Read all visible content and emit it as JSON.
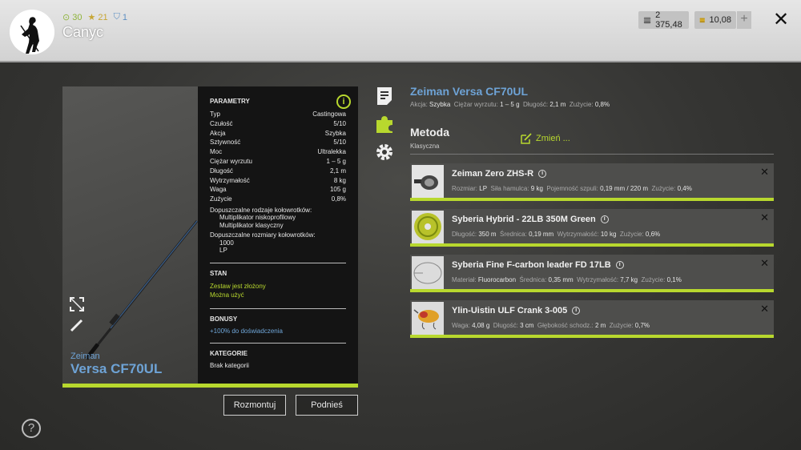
{
  "player": {
    "name": "Canyc",
    "stat_level": "30",
    "stat_stars": "21",
    "stat_third": "1"
  },
  "currency": {
    "silver": "2 375,48",
    "gold": "10,08",
    "add_symbol": "+"
  },
  "close_symbol": "✕",
  "item": {
    "brand": "Zeiman",
    "model": "Versa CF70UL",
    "info_symbol": "i"
  },
  "params": {
    "title": "PARAMETRY",
    "rows": [
      {
        "k": "Typ",
        "v": "Castingowa"
      },
      {
        "k": "Czułość",
        "v": "5/10"
      },
      {
        "k": "Akcja",
        "v": "Szybka"
      },
      {
        "k": "Sztywność",
        "v": "5/10"
      },
      {
        "k": "Moc",
        "v": "Ultralekka"
      },
      {
        "k": "Ciężar wyrzutu",
        "v": "1 – 5 g"
      },
      {
        "k": "Długość",
        "v": "2,1 m"
      },
      {
        "k": "Wytrzymałość",
        "v": "8 kg"
      },
      {
        "k": "Waga",
        "v": "105 g"
      },
      {
        "k": "Zużycie",
        "v": "0,8%"
      }
    ],
    "reel_types_label": "Dopuszczalne rodzaje kołowrotków:",
    "reel_types": [
      "Multiplikator niskoprofilowy",
      "Multiplikator klasyczny"
    ],
    "reel_sizes_label": "Dopuszczalne rozmiary kołowrotków:",
    "reel_sizes": [
      "1000",
      "LP"
    ],
    "state_title": "STAN",
    "state_lines": [
      "Zestaw jest złożony",
      "Można użyć"
    ],
    "bonus_title": "BONUSY",
    "bonus_text": "+100% do doświadczenia",
    "category_title": "KATEGORIE",
    "category_text": "Brak kategorii"
  },
  "buttons": {
    "dismantle": "Rozmontuj",
    "pick_up": "Podnieś",
    "help": "?"
  },
  "rod": {
    "title": "Zeiman Versa CF70UL",
    "sub": [
      {
        "k": "Akcja:",
        "v": "Szybka"
      },
      {
        "k": "Ciężar wyrzutu:",
        "v": "1 – 5 g"
      },
      {
        "k": "Długość:",
        "v": "2,1 m"
      },
      {
        "k": "Zużycie:",
        "v": "0,8%"
      }
    ]
  },
  "method": {
    "title": "Metoda",
    "value": "Klasyczna",
    "change_label": "Zmień ..."
  },
  "components": [
    {
      "name": "Zeiman Zero ZHS-R",
      "details": [
        {
          "k": "Rozmiar:",
          "v": "LP"
        },
        {
          "k": "Siła hamulca:",
          "v": "9 kg"
        },
        {
          "k": "Pojemność szpuli:",
          "v": "0,19 mm / 220 m"
        },
        {
          "k": "Zużycie:",
          "v": "0,4%"
        }
      ]
    },
    {
      "name": "Syberia Hybrid - 22LB 350M Green",
      "details": [
        {
          "k": "Długość:",
          "v": "350 m"
        },
        {
          "k": "Średnica:",
          "v": "0,19 mm"
        },
        {
          "k": "Wytrzymałość:",
          "v": "10 kg"
        },
        {
          "k": "Zużycie:",
          "v": "0,6%"
        }
      ]
    },
    {
      "name": "Syberia Fine F-carbon leader FD 17LB",
      "details": [
        {
          "k": "Materiał:",
          "v": "Fluorocarbon"
        },
        {
          "k": "Średnica:",
          "v": "0,35 mm"
        },
        {
          "k": "Wytrzymałość:",
          "v": "7,7 kg"
        },
        {
          "k": "Zużycie:",
          "v": "0,1%"
        }
      ]
    },
    {
      "name": "Ylin-Uistin ULF Crank 3-005",
      "details": [
        {
          "k": "Waga:",
          "v": "4,08 g"
        },
        {
          "k": "Długość:",
          "v": "3 cm"
        },
        {
          "k": "Głębokość schodz.:",
          "v": "2 m"
        },
        {
          "k": "Zużycie:",
          "v": "0,7%"
        }
      ]
    }
  ],
  "colors": {
    "accent_green": "#b8d82e",
    "accent_blue": "#6ea3d6"
  }
}
